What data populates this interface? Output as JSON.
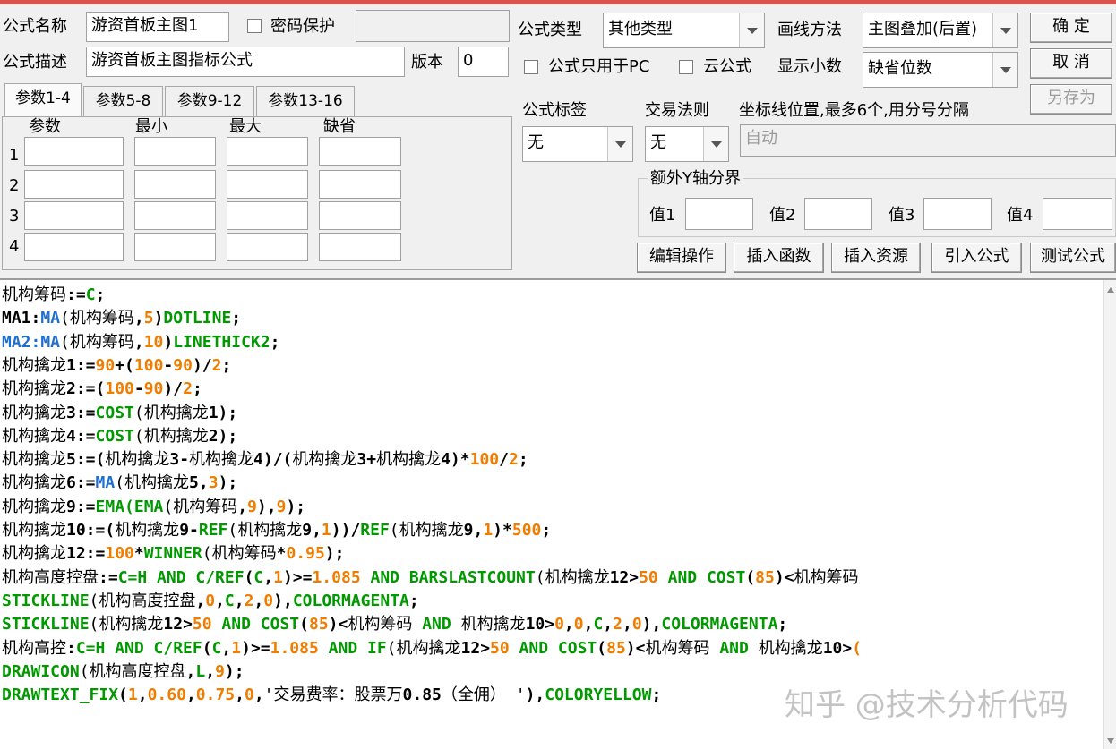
{
  "form": {
    "name_label": "公式名称",
    "name_value": "游资首板主图1",
    "password_label": "密码保护",
    "desc_label": "公式描述",
    "desc_value": "游资首板主图指标公式",
    "version_label": "版本",
    "version_value": "0",
    "type_label": "公式类型",
    "type_value": "其他类型",
    "draw_label": "画线方法",
    "draw_value": "主图叠加(后置)",
    "pc_only_label": "公式只用于PC",
    "cloud_label": "云公式",
    "decimal_label": "显示小数",
    "decimal_value": "缺省位数",
    "tag_label": "公式标签",
    "tag_value": "无",
    "rule_label": "交易法则",
    "rule_value": "无",
    "axis_label": "坐标线位置,最多6个,用分号分隔",
    "axis_placeholder": "自动",
    "extra_y_label": "额外Y轴分界",
    "val_labels": [
      "值1",
      "值2",
      "值3",
      "值4"
    ]
  },
  "buttons": {
    "ok": "确  定",
    "cancel": "取  消",
    "save_as": "另存为",
    "edit_ops": "编辑操作",
    "insert_func": "插入函数",
    "insert_res": "插入资源",
    "import_formula": "引入公式",
    "test_formula": "测试公式"
  },
  "tabs": [
    "参数1-4",
    "参数5-8",
    "参数9-12",
    "参数13-16"
  ],
  "params": {
    "headers": [
      "参数",
      "最小",
      "最大",
      "缺省"
    ],
    "rows": [
      "1",
      "2",
      "3",
      "4"
    ]
  },
  "code_lines": [
    [
      [
        "k",
        "机构筹码"
      ],
      [
        "n",
        ":="
      ],
      [
        "g",
        "C"
      ],
      [
        "n",
        ";"
      ]
    ],
    [
      [
        "n",
        "MA1:"
      ],
      [
        "b",
        "MA"
      ],
      [
        "k",
        "(机构筹码"
      ],
      [
        "n",
        ","
      ],
      [
        "o",
        "5"
      ],
      [
        "n",
        ")"
      ],
      [
        "g",
        "DOTLINE"
      ],
      [
        "n",
        ";"
      ]
    ],
    [
      [
        "b",
        "MA2:MA"
      ],
      [
        "k",
        "(机构筹码"
      ],
      [
        "n",
        ","
      ],
      [
        "o",
        "10"
      ],
      [
        "n",
        ")"
      ],
      [
        "g",
        "LINETHICK2"
      ],
      [
        "n",
        ";"
      ]
    ],
    [
      [
        "k",
        "机构擒龙"
      ],
      [
        "n",
        "1:="
      ],
      [
        "o",
        "90"
      ],
      [
        "n",
        "+("
      ],
      [
        "o",
        "100"
      ],
      [
        "n",
        "-"
      ],
      [
        "o",
        "90"
      ],
      [
        "n",
        ")/"
      ],
      [
        "o",
        "2"
      ],
      [
        "n",
        ";"
      ]
    ],
    [
      [
        "k",
        "机构擒龙"
      ],
      [
        "n",
        "2:=("
      ],
      [
        "o",
        "100"
      ],
      [
        "n",
        "-"
      ],
      [
        "o",
        "90"
      ],
      [
        "n",
        ")/"
      ],
      [
        "o",
        "2"
      ],
      [
        "n",
        ";"
      ]
    ],
    [
      [
        "k",
        "机构擒龙"
      ],
      [
        "n",
        "3:="
      ],
      [
        "g",
        "COST"
      ],
      [
        "k",
        "(机构擒龙"
      ],
      [
        "n",
        "1);"
      ]
    ],
    [
      [
        "k",
        "机构擒龙"
      ],
      [
        "n",
        "4:="
      ],
      [
        "g",
        "COST"
      ],
      [
        "k",
        "(机构擒龙"
      ],
      [
        "n",
        "2);"
      ]
    ],
    [
      [
        "k",
        "机构擒龙"
      ],
      [
        "n",
        "5:=("
      ],
      [
        "k",
        "机构擒龙"
      ],
      [
        "n",
        "3-"
      ],
      [
        "k",
        "机构擒龙"
      ],
      [
        "n",
        "4)/("
      ],
      [
        "k",
        "机构擒龙"
      ],
      [
        "n",
        "3+"
      ],
      [
        "k",
        "机构擒龙"
      ],
      [
        "n",
        "4)*"
      ],
      [
        "o",
        "100"
      ],
      [
        "n",
        "/"
      ],
      [
        "o",
        "2"
      ],
      [
        "n",
        ";"
      ]
    ],
    [
      [
        "k",
        "机构擒龙"
      ],
      [
        "n",
        "6:="
      ],
      [
        "b",
        "MA"
      ],
      [
        "k",
        "(机构擒龙"
      ],
      [
        "n",
        "5,"
      ],
      [
        "o",
        "3"
      ],
      [
        "n",
        ");"
      ]
    ],
    [
      [
        "k",
        "机构擒龙"
      ],
      [
        "n",
        "9:="
      ],
      [
        "g",
        "EMA(EMA"
      ],
      [
        "k",
        "(机构筹码"
      ],
      [
        "n",
        ","
      ],
      [
        "o",
        "9"
      ],
      [
        "n",
        "),"
      ],
      [
        "o",
        "9"
      ],
      [
        "n",
        ");"
      ]
    ],
    [
      [
        "k",
        "机构擒龙"
      ],
      [
        "n",
        "10:=("
      ],
      [
        "k",
        "机构擒龙"
      ],
      [
        "n",
        "9-"
      ],
      [
        "g",
        "REF"
      ],
      [
        "k",
        "(机构擒龙"
      ],
      [
        "n",
        "9,"
      ],
      [
        "o",
        "1"
      ],
      [
        "n",
        "))/"
      ],
      [
        "g",
        "REF"
      ],
      [
        "k",
        "(机构擒龙"
      ],
      [
        "n",
        "9,"
      ],
      [
        "o",
        "1"
      ],
      [
        "n",
        ")*"
      ],
      [
        "o",
        "500"
      ],
      [
        "n",
        ";"
      ]
    ],
    [
      [
        "k",
        "机构擒龙"
      ],
      [
        "n",
        "12:="
      ],
      [
        "o",
        "100"
      ],
      [
        "n",
        "*"
      ],
      [
        "g",
        "WINNER"
      ],
      [
        "k",
        "(机构筹码"
      ],
      [
        "n",
        "*"
      ],
      [
        "o",
        "0.95"
      ],
      [
        "n",
        ");"
      ]
    ],
    [
      [
        "k",
        "机构高度控盘"
      ],
      [
        "n",
        ":="
      ],
      [
        "g",
        "C=H AND C/REF"
      ],
      [
        "n",
        "("
      ],
      [
        "g",
        "C"
      ],
      [
        "n",
        ","
      ],
      [
        "o",
        "1"
      ],
      [
        "n",
        ")>="
      ],
      [
        "o",
        "1.085"
      ],
      [
        "g",
        " AND BARSLASTCOUNT"
      ],
      [
        "k",
        "(机构擒龙"
      ],
      [
        "n",
        "12>"
      ],
      [
        "o",
        "50"
      ],
      [
        "g",
        " AND COST"
      ],
      [
        "n",
        "("
      ],
      [
        "o",
        "85"
      ],
      [
        "n",
        ")<"
      ],
      [
        "k",
        "机构筹码"
      ]
    ],
    [
      [
        "g",
        "STICKLINE"
      ],
      [
        "k",
        "(机构高度控盘"
      ],
      [
        "n",
        ","
      ],
      [
        "o",
        "0"
      ],
      [
        "n",
        ","
      ],
      [
        "g",
        "C"
      ],
      [
        "n",
        ","
      ],
      [
        "o",
        "2"
      ],
      [
        "n",
        ","
      ],
      [
        "o",
        "0"
      ],
      [
        "n",
        "),"
      ],
      [
        "g",
        "COLORMAGENTA"
      ],
      [
        "n",
        ";"
      ]
    ],
    [
      [
        "g",
        "STICKLINE"
      ],
      [
        "k",
        "(机构擒龙"
      ],
      [
        "n",
        "12>"
      ],
      [
        "o",
        "50"
      ],
      [
        "g",
        " AND COST"
      ],
      [
        "n",
        "("
      ],
      [
        "o",
        "85"
      ],
      [
        "n",
        ")<"
      ],
      [
        "k",
        "机构筹码 "
      ],
      [
        "g",
        "AND "
      ],
      [
        "k",
        "机构擒龙"
      ],
      [
        "n",
        "10>"
      ],
      [
        "o",
        "0"
      ],
      [
        "n",
        ","
      ],
      [
        "o",
        "0"
      ],
      [
        "n",
        ","
      ],
      [
        "g",
        "C"
      ],
      [
        "n",
        ","
      ],
      [
        "o",
        "2"
      ],
      [
        "n",
        ","
      ],
      [
        "o",
        "0"
      ],
      [
        "n",
        "),"
      ],
      [
        "g",
        "COLORMAGENTA"
      ],
      [
        "n",
        ";"
      ]
    ],
    [
      [
        "k",
        "机构高控"
      ],
      [
        "n",
        ":"
      ],
      [
        "g",
        "C=H AND C/REF"
      ],
      [
        "n",
        "("
      ],
      [
        "g",
        "C"
      ],
      [
        "n",
        ","
      ],
      [
        "o",
        "1"
      ],
      [
        "n",
        ")>="
      ],
      [
        "o",
        "1.085"
      ],
      [
        "g",
        " AND IF"
      ],
      [
        "k",
        "(机构擒龙"
      ],
      [
        "n",
        "12>"
      ],
      [
        "o",
        "50"
      ],
      [
        "g",
        " AND COST"
      ],
      [
        "n",
        "("
      ],
      [
        "o",
        "85"
      ],
      [
        "n",
        ")<"
      ],
      [
        "k",
        "机构筹码 "
      ],
      [
        "g",
        "AND "
      ],
      [
        "k",
        "机构擒龙"
      ],
      [
        "n",
        "10>"
      ],
      [
        "o",
        "("
      ]
    ],
    [
      [
        "g",
        "DRAWICON"
      ],
      [
        "k",
        "(机构高度控盘"
      ],
      [
        "n",
        ","
      ],
      [
        "g",
        "L"
      ],
      [
        "n",
        ","
      ],
      [
        "o",
        "9"
      ],
      [
        "n",
        ");"
      ]
    ],
    [
      [
        "g",
        "DRAWTEXT_FIX"
      ],
      [
        "n",
        "("
      ],
      [
        "o",
        "1"
      ],
      [
        "n",
        ","
      ],
      [
        "o",
        "0.60"
      ],
      [
        "n",
        ","
      ],
      [
        "o",
        "0.75"
      ],
      [
        "n",
        ","
      ],
      [
        "o",
        "0"
      ],
      [
        "n",
        ","
      ],
      [
        "k",
        "'交易费率：股票万"
      ],
      [
        "n",
        "0.85"
      ],
      [
        "k",
        "（全佣） '"
      ],
      [
        "n",
        "),"
      ],
      [
        "g",
        "COLORYELLOW"
      ],
      [
        "n",
        ";"
      ]
    ]
  ],
  "watermark": "知乎 @技术分析代码"
}
